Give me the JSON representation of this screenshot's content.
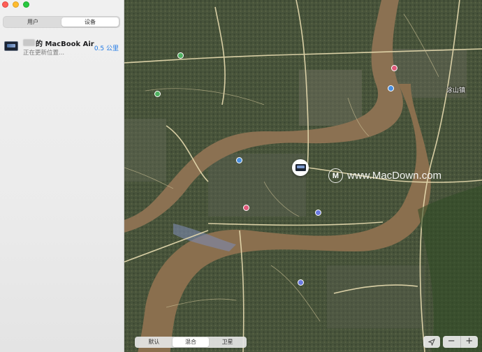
{
  "window": {
    "traffic_lights": [
      "close",
      "minimize",
      "zoom"
    ]
  },
  "sidebar": {
    "tabs": [
      {
        "label": "用户",
        "active": false
      },
      {
        "label": "设备",
        "active": true
      }
    ],
    "devices": [
      {
        "name": "的 MacBook Air",
        "status": "正在更新位置...",
        "distance": "0.5 公里",
        "icon": "macbook-icon"
      }
    ]
  },
  "map": {
    "town_label": "涂山镇",
    "watermark": "www.MacDown.com",
    "map_types": [
      {
        "label": "默认",
        "active": false
      },
      {
        "label": "混合",
        "active": true
      },
      {
        "label": "卫星",
        "active": false
      }
    ],
    "zoom_out": "−",
    "zoom_in": "+",
    "colors": {
      "river": "#8a6f4e",
      "road": "#e8dcb0",
      "accent": "#1e78e6"
    }
  }
}
